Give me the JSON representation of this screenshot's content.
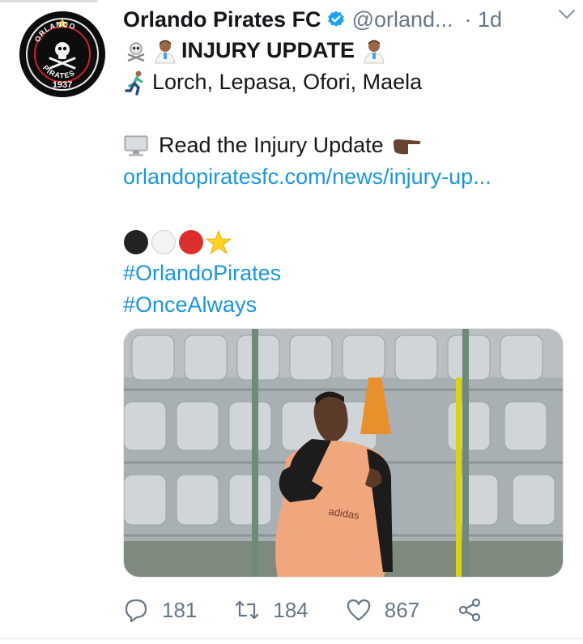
{
  "tweet": {
    "account_name": "Orlando Pirates FC",
    "handle": "@orland...",
    "time": "· 1d",
    "avatar_badge": {
      "top_text": "ORLANDO",
      "bottom_text": "PIRATES",
      "year": "1937"
    },
    "lines": {
      "title": "INJURY UPDATE",
      "players": "Lorch, Lepasa, Ofori, Maela",
      "read_text": "Read the Injury Update",
      "link": "orlandopiratesfc.com/news/injury-up...",
      "hashtag1": "#OrlandoPirates",
      "hashtag2": "#OnceAlways"
    },
    "media": {
      "vest_text": "adidas"
    },
    "actions": {
      "replies": "181",
      "retweets": "184",
      "likes": "867"
    },
    "colors": {
      "link": "#1b95e0",
      "verified": "#1da1f2",
      "muted": "#657786"
    },
    "icons": [
      "verified-badge-icon",
      "chevron-down-icon",
      "skull-emoji-icon",
      "health-worker-emoji-icon",
      "runner-emoji-icon",
      "computer-emoji-icon",
      "pointing-hand-emoji-icon",
      "black-circle-emoji-icon",
      "white-circle-emoji-icon",
      "red-circle-emoji-icon",
      "star-emoji-icon",
      "reply-icon",
      "retweet-icon",
      "like-icon",
      "share-icon"
    ]
  }
}
